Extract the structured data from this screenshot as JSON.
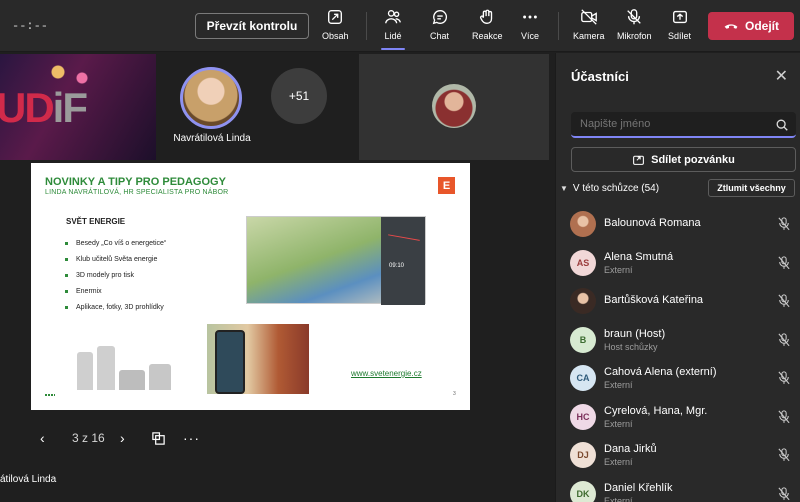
{
  "topbar": {
    "timer": "--:--",
    "control_label": "Převzít kontrolu",
    "tools": [
      {
        "label": "Obsah",
        "icon": "share-screen-icon"
      },
      {
        "label": "Lidé",
        "icon": "people-icon"
      },
      {
        "label": "Chat",
        "icon": "chat-icon"
      },
      {
        "label": "Reakce",
        "icon": "reactions-icon"
      },
      {
        "label": "Více",
        "icon": "more-icon"
      },
      {
        "label": "Kamera",
        "icon": "camera-off-icon"
      },
      {
        "label": "Mikrofon",
        "icon": "mic-off-icon"
      },
      {
        "label": "Sdílet",
        "icon": "share-icon"
      }
    ],
    "leave_label": "Odejít",
    "leave_color": "#c4314b",
    "accent_color": "#7f85f5"
  },
  "stage": {
    "photo_text_a": "UD",
    "photo_text_b": "i",
    "photo_text_c": "F",
    "presenter_tile_name": "Navrátilová Linda",
    "more_count": "+51",
    "presenter_label": "átilová Linda"
  },
  "slide": {
    "title": "NOVINKY A TIPY PRO PEDAGOGY",
    "subtitle": "LINDA NAVRÁTILOVÁ, HR SPECIALISTA PRO NÁBOR",
    "logo": "E",
    "section": "SVĚT ENERGIE",
    "bullets": [
      "Besedy „Co víš o energetice“",
      "Klub učitelů Světa energie",
      "3D modely pro tisk",
      "Enermix",
      "Aplikace, fotky, 3D prohlídky"
    ],
    "map_time": "09:10",
    "url": "www.svetenergie.cz",
    "page": "3"
  },
  "slide_nav": {
    "prev": "‹",
    "count": "3 z 16",
    "next": "›",
    "more": "···"
  },
  "sidebar": {
    "title": "Účastníci",
    "close": "✕",
    "search_placeholder": "Napište jméno",
    "share_label": "Sdílet pozvánku",
    "group_label": "V této schůzce (54)",
    "mute_all": "Ztlumit všechny",
    "participants": [
      {
        "name": "Balounová Romana",
        "role": "",
        "initials": "",
        "photo": true,
        "av_color": "#b07050"
      },
      {
        "name": "Alena Smutná",
        "role": "Externí",
        "initials": "AS",
        "photo": false,
        "av_color": "#f1d7d7",
        "fg": "#9a3b3b"
      },
      {
        "name": "Bartůšková Kateřina",
        "role": "",
        "initials": "",
        "photo": true,
        "av_color": "#3a2a24"
      },
      {
        "name": "braun (Host)",
        "role": "Host schůzky",
        "initials": "B",
        "photo": false,
        "av_color": "#d7ead1",
        "fg": "#3b6b2f"
      },
      {
        "name": "Cahová Alena (externí)",
        "role": "Externí",
        "initials": "CA",
        "photo": false,
        "av_color": "#d6e6f2",
        "fg": "#2f5b7b"
      },
      {
        "name": "Cyrelová, Hana, Mgr.",
        "role": "Externí",
        "initials": "HC",
        "photo": false,
        "av_color": "#efd9e6",
        "fg": "#7b2f5b"
      },
      {
        "name": "Dana Jirků",
        "role": "Externí",
        "initials": "DJ",
        "photo": false,
        "av_color": "#efe0d6",
        "fg": "#7b4a2f"
      },
      {
        "name": "Daniel Křehlík",
        "role": "Externí",
        "initials": "DK",
        "photo": false,
        "av_color": "#dde9d3",
        "fg": "#3f6b2f"
      }
    ]
  }
}
